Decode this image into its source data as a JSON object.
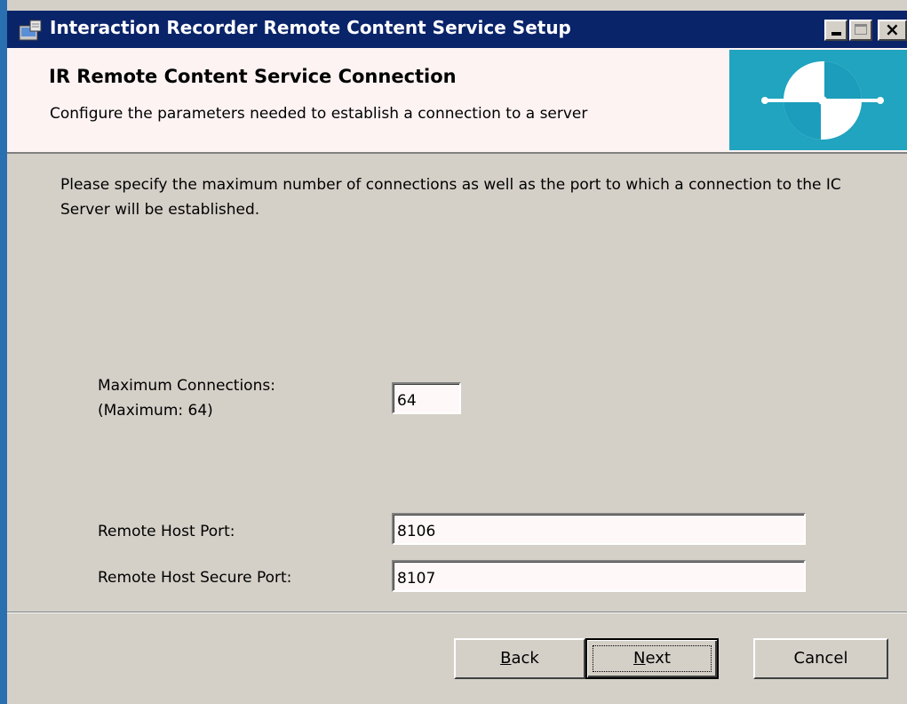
{
  "window": {
    "title": "Interaction Recorder Remote Content Service Setup"
  },
  "banner": {
    "heading": "IR Remote Content Service Connection",
    "subheading": "Configure the parameters needed to establish a connection to a server"
  },
  "intro_text": "Please specify the maximum number of connections as well as the port to which a connection to the IC Server will be established.",
  "fields": {
    "max_connections": {
      "label_line1": "Maximum Connections:",
      "label_line2": "(Maximum: 64)",
      "value": "64"
    },
    "remote_host_port": {
      "label": "Remote Host Port:",
      "value": "8106"
    },
    "remote_host_secure_port": {
      "label": "Remote Host Secure Port:",
      "value": "8107"
    }
  },
  "buttons": {
    "back": {
      "access_key": "B",
      "rest": "ack"
    },
    "next": {
      "access_key": "N",
      "rest": "ext"
    },
    "cancel": "Cancel"
  },
  "colors": {
    "titlebar": "#0a246a",
    "dialog_bg": "#d4d0c8",
    "banner_bg": "#fdf3f3",
    "logo_bg": "#1b9dbb"
  }
}
